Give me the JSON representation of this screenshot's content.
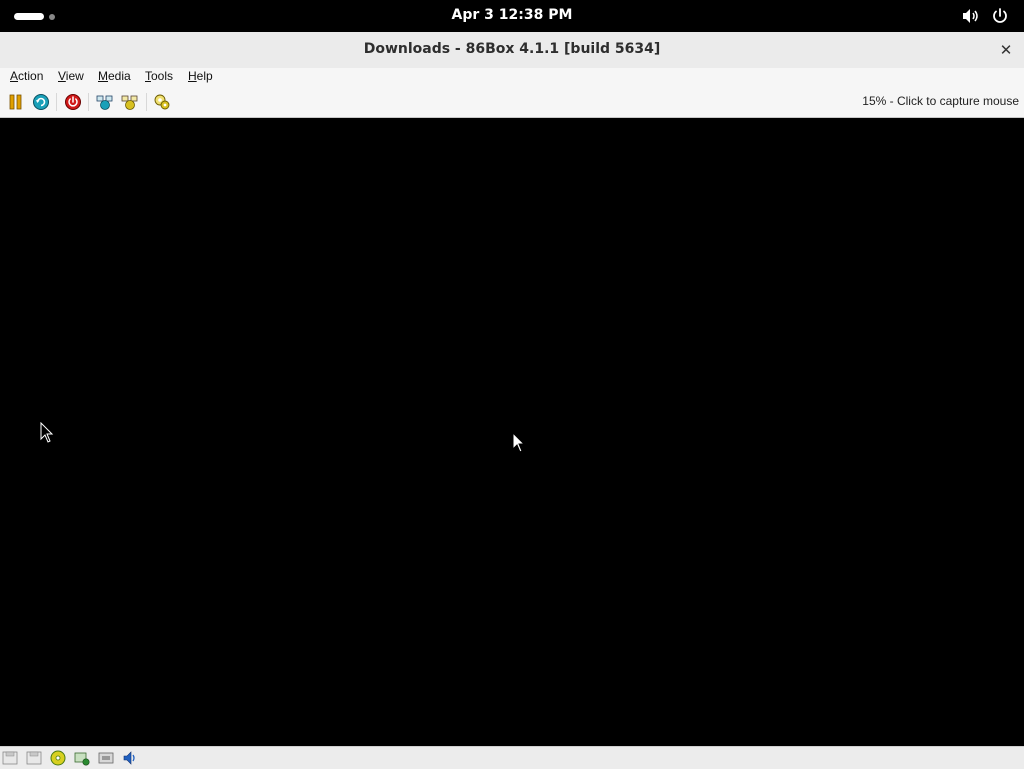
{
  "topbar": {
    "clock": "Apr 3  12:38 PM",
    "icons": [
      "activities-indicator",
      "volume-icon",
      "power-icon"
    ]
  },
  "window": {
    "title": "Downloads - 86Box 4.1.1 [build 5634]",
    "close_label": "✕"
  },
  "menu": {
    "items": [
      {
        "label": "Action"
      },
      {
        "label": "View"
      },
      {
        "label": "Media"
      },
      {
        "label": "Tools"
      },
      {
        "label": "Help"
      }
    ]
  },
  "toolbar": {
    "buttons": [
      "pause-icon",
      "hard-reset-icon",
      "power-off-icon",
      "ctrl-alt-del-icon",
      "ctrl-alt-esc-icon",
      "settings-icon"
    ],
    "capture_hint": "15% - Click to capture mouse"
  },
  "statusbar": {
    "icons": [
      "floppy-drive-1-icon",
      "floppy-drive-2-icon",
      "cdrom-icon",
      "hard-disk-icon",
      "network-icon",
      "sound-icon"
    ]
  },
  "colors": {
    "topbar_bg": "#000000",
    "window_chrome": "#ebebeb",
    "screen_bg": "#000000",
    "pause_accent": "#e0a000",
    "reset_accent": "#1aa0b8",
    "power_accent": "#d01818"
  }
}
